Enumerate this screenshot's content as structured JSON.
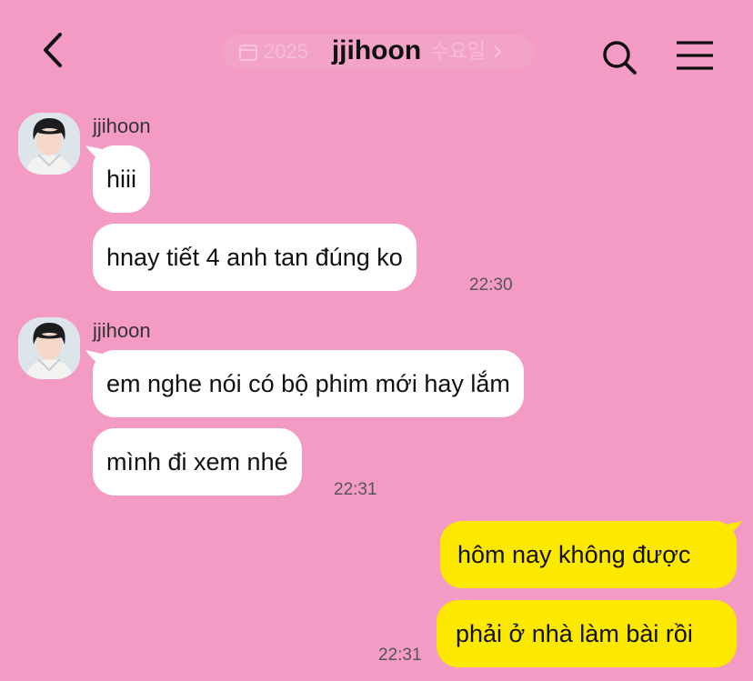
{
  "theme": {
    "background": "#f39bc4",
    "incoming_bubble": "#ffffff",
    "outgoing_bubble": "#fde800"
  },
  "header": {
    "title": "jjihoon",
    "back_icon": "chevron-left-icon",
    "search_icon": "search-icon",
    "menu_icon": "menu-icon",
    "date_pill": {
      "icon": "calendar-icon",
      "text": "2025",
      "weekday": "수요일",
      "chevron": "chevron-right-icon"
    }
  },
  "messages": [
    {
      "sender": "jjihoon",
      "bubbles": [
        "hiii",
        "hnay tiết 4 anh tan đúng ko"
      ],
      "time": "22:30"
    },
    {
      "sender": "jjihoon",
      "bubbles": [
        "em nghe nói có bộ phim mới hay lắm",
        "mình đi xem nhé"
      ],
      "time": "22:31"
    },
    {
      "sender": "me",
      "bubbles": [
        "hôm nay không được",
        "phải ở nhà làm bài rồi"
      ],
      "time": "22:31"
    }
  ]
}
